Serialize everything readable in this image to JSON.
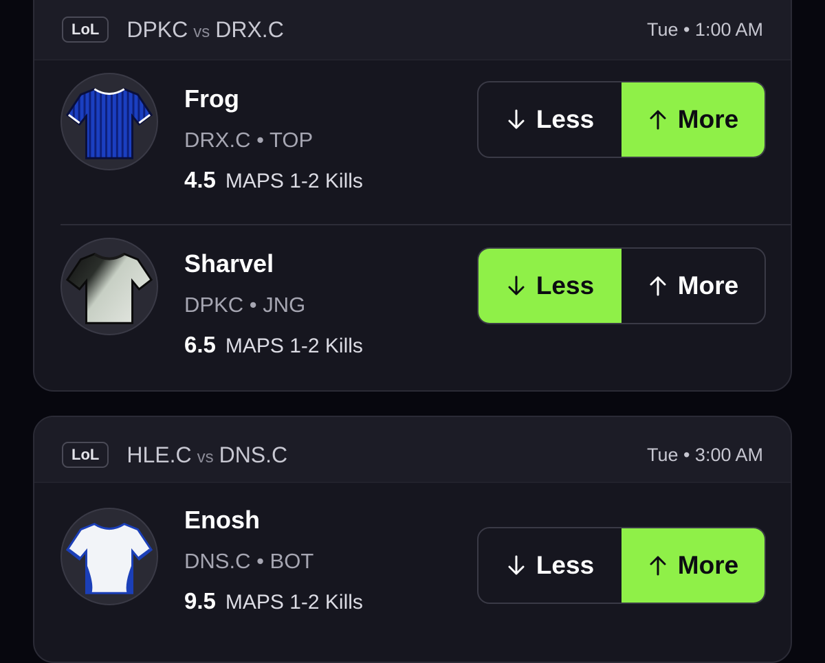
{
  "colors": {
    "background": "#07070e",
    "card": "#16161f",
    "card_header": "#1c1c26",
    "accent_green": "#8ff048"
  },
  "matches": [
    {
      "game_tag": "LoL",
      "team_a": "DPKC",
      "vs": "vs",
      "team_b": "DRX.C",
      "time": "Tue • 1:00 AM",
      "players": [
        {
          "name": "Frog",
          "team_position": "DRX.C • TOP",
          "line_value": "4.5",
          "stat": "MAPS 1-2 Kills",
          "jersey": "blue-striped",
          "less_label": "Less",
          "more_label": "More",
          "selected": "more"
        },
        {
          "name": "Sharvel",
          "team_position": "DPKC • JNG",
          "line_value": "6.5",
          "stat": "MAPS 1-2 Kills",
          "jersey": "black-white",
          "less_label": "Less",
          "more_label": "More",
          "selected": "less"
        }
      ]
    },
    {
      "game_tag": "LoL",
      "team_a": "HLE.C",
      "vs": "vs",
      "team_b": "DNS.C",
      "time": "Tue • 3:00 AM",
      "players": [
        {
          "name": "Enosh",
          "team_position": "DNS.C • BOT",
          "line_value": "9.5",
          "stat": "MAPS 1-2 Kills",
          "jersey": "white-blue",
          "less_label": "Less",
          "more_label": "More",
          "selected": "more"
        }
      ]
    }
  ],
  "icons": {
    "less": "arrow-down-icon",
    "more": "arrow-up-icon",
    "avatar": "jersey-icon"
  }
}
